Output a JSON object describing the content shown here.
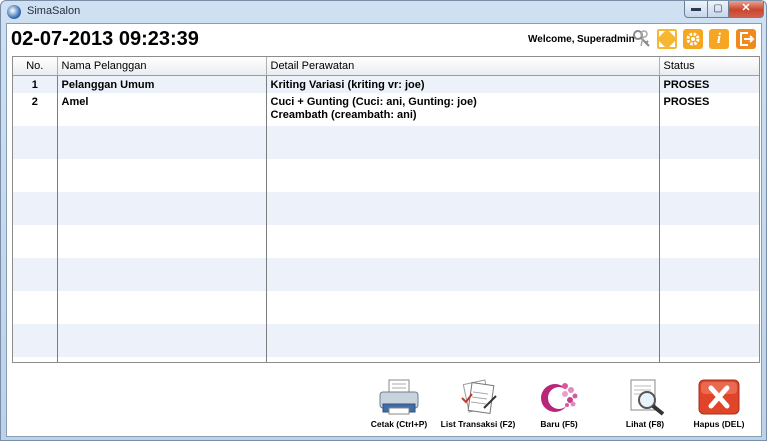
{
  "window": {
    "title": "SimaSalon",
    "min_label": "▬",
    "max_label": "▢",
    "close_label": "✕"
  },
  "header": {
    "datetime": "02-07-2013 09:23:39",
    "welcome_label": "Welcome,",
    "user": "Superadmin",
    "info_glyph": "i"
  },
  "table": {
    "columns": [
      "No.",
      "Nama Pelanggan",
      "Detail Perawatan",
      "Status"
    ],
    "rows": [
      {
        "no": "1",
        "nama": "Pelanggan Umum",
        "detail_1": "Kriting Variasi (kriting vr: joe)",
        "detail_2": "",
        "status": "PROSES"
      },
      {
        "no": "2",
        "nama": "Amel",
        "detail_1": "Cuci + Gunting (Cuci: ani, Gunting: joe)",
        "detail_2": "Creambath (creambath: ani)",
        "status": "PROSES"
      }
    ]
  },
  "toolbar": {
    "cetak": "Cetak (Ctrl+P)",
    "list_transaksi": "List Transaksi (F2)",
    "baru": "Baru (F5)",
    "lihat": "Lihat (F8)",
    "hapus": "Hapus (DEL)"
  },
  "colors": {
    "row_alt": "#edf2fa",
    "accent_orange": "#f5a623",
    "delete_red": "#e0452a"
  }
}
